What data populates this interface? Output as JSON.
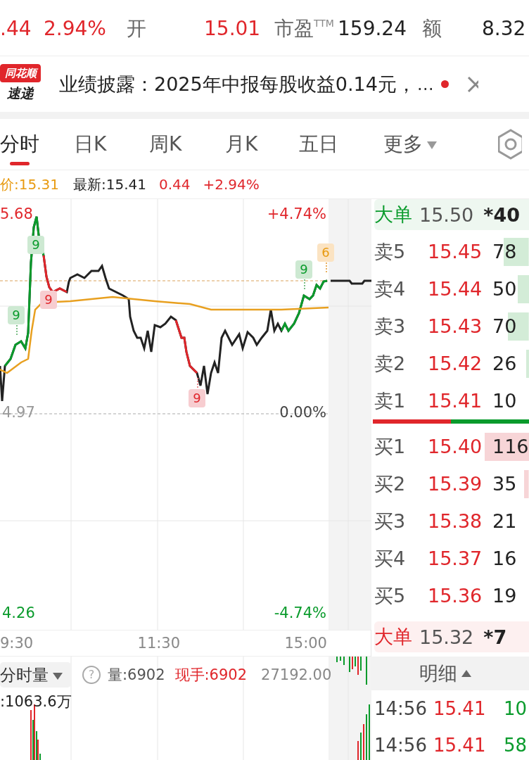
{
  "quote": {
    "change": ".44",
    "change_pct": "2.94%",
    "open_label": "开",
    "open": "15.01",
    "pe_label": "市盈$^{TTM}$",
    "pe": "159.24",
    "amount_label": "额",
    "amount": "8.32"
  },
  "news": {
    "badge_top": "同花顺",
    "badge_bottom": "速递",
    "text": "业绩披露：2025年中报每股收益0.14元，",
    "more": "…",
    "unread": true
  },
  "tabs": [
    {
      "label": "分时",
      "selected": true,
      "kind": "tab"
    },
    {
      "label": "日K",
      "selected": false,
      "kind": "tab"
    },
    {
      "label": "周K",
      "selected": false,
      "kind": "tab"
    },
    {
      "label": "月K",
      "selected": false,
      "kind": "tab"
    },
    {
      "label": "五日",
      "selected": false,
      "kind": "tab"
    },
    {
      "label": "更多",
      "selected": false,
      "kind": "menu"
    }
  ],
  "info": {
    "avg": "价:15.31",
    "latest": "最新:15.41",
    "change": "0.44",
    "change_pct": "+2.94%"
  },
  "chart": {
    "price_high": "5.68",
    "pct_high": "+4.74%",
    "price_base": "4.97",
    "pct_base": "0.00%",
    "price_low": "4.26",
    "pct_low": "-4.74%",
    "times": [
      "9:30",
      "11:30",
      "15:00"
    ],
    "signals": [
      {
        "label": "9",
        "kind": "up"
      },
      {
        "label": "9",
        "kind": "up"
      },
      {
        "label": "9",
        "kind": "down"
      },
      {
        "label": "9",
        "kind": "down"
      },
      {
        "label": "9",
        "kind": "up"
      },
      {
        "label": "6",
        "kind": "pending"
      }
    ]
  },
  "volume": {
    "selector": "分时量",
    "help": "?",
    "volume": "量:6902",
    "current": "现手:6902",
    "max": "27192.00",
    "amount": ":1063.6万"
  },
  "depth": {
    "big_top": {
      "label": "大单",
      "price": "15.50",
      "volume": "*40"
    },
    "asks": [
      {
        "label": "卖5",
        "price": "15.45",
        "volume": "78"
      },
      {
        "label": "卖4",
        "price": "15.44",
        "volume": "50"
      },
      {
        "label": "卖3",
        "price": "15.43",
        "volume": "70"
      },
      {
        "label": "卖2",
        "price": "15.42",
        "volume": "26"
      },
      {
        "label": "卖1",
        "price": "15.41",
        "volume": "10"
      }
    ],
    "ratio": {
      "level": 0.5
    },
    "bids": [
      {
        "label": "买1",
        "price": "15.40",
        "volume": "116"
      },
      {
        "label": "买2",
        "price": "15.39",
        "volume": "35"
      },
      {
        "label": "买3",
        "price": "15.38",
        "volume": "21"
      },
      {
        "label": "买4",
        "price": "15.37",
        "volume": "16"
      },
      {
        "label": "买5",
        "price": "15.36",
        "volume": "19"
      }
    ],
    "big_bottom": {
      "label": "大单",
      "price": "15.32",
      "volume": "*7"
    },
    "detail_header": "明细",
    "trades": [
      {
        "time": "14:56",
        "price": "15.41",
        "volume": "10"
      },
      {
        "time": "14:56",
        "price": "15.41",
        "volume": "58"
      }
    ]
  }
}
